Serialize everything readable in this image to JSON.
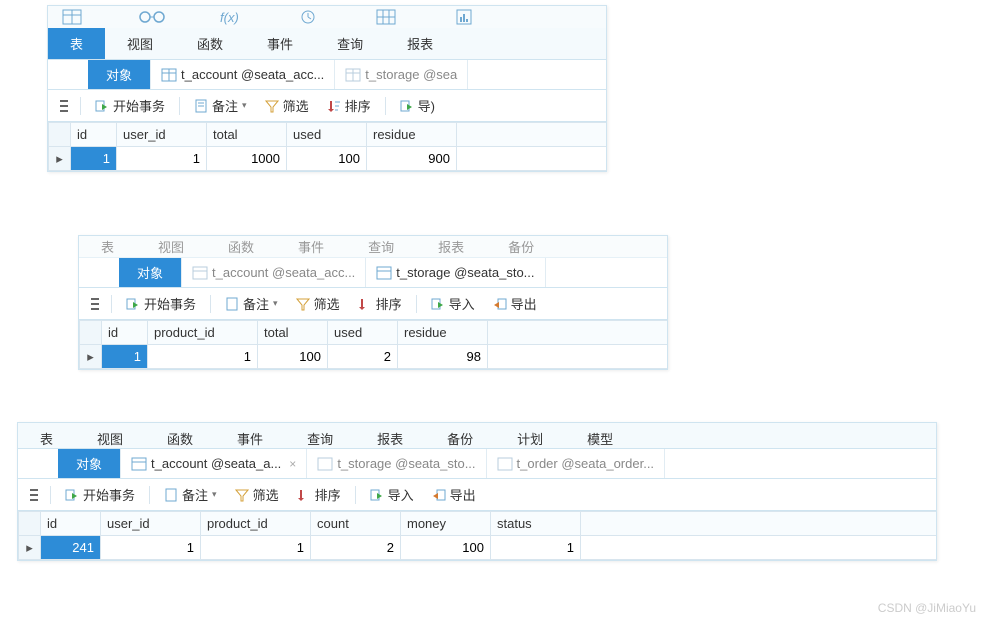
{
  "watermark": "CSDN @JiMiaoYu",
  "menu": {
    "table": "表",
    "view": "视图",
    "function": "函数",
    "event": "事件",
    "query": "查询",
    "report": "报表",
    "backup": "备份",
    "plan": "计划",
    "model": "模型"
  },
  "tabs": {
    "object": "对象",
    "account": "t_account @seata_acc...",
    "account_short": "t_account @seata_a...",
    "storage": "t_storage @sea",
    "storage_mid": "t_storage @seata_sto...",
    "order": "t_order @seata_order..."
  },
  "toolbar": {
    "begin": "开始事务",
    "memo": "备注",
    "filter": "筛选",
    "sort": "排序",
    "import": "导入",
    "export": "导出",
    "import_short": "导)"
  },
  "panel1": {
    "headers": [
      "id",
      "user_id",
      "total",
      "used",
      "residue"
    ],
    "row": {
      "id": "1",
      "user_id": "1",
      "total": "1000",
      "used": "100",
      "residue": "900"
    }
  },
  "panel2": {
    "headers": [
      "id",
      "product_id",
      "total",
      "used",
      "residue"
    ],
    "row": {
      "id": "1",
      "product_id": "1",
      "total": "100",
      "used": "2",
      "residue": "98"
    }
  },
  "panel3": {
    "headers": [
      "id",
      "user_id",
      "product_id",
      "count",
      "money",
      "status"
    ],
    "row": {
      "id": "241",
      "user_id": "1",
      "product_id": "1",
      "count": "2",
      "money": "100",
      "status": "1"
    }
  }
}
